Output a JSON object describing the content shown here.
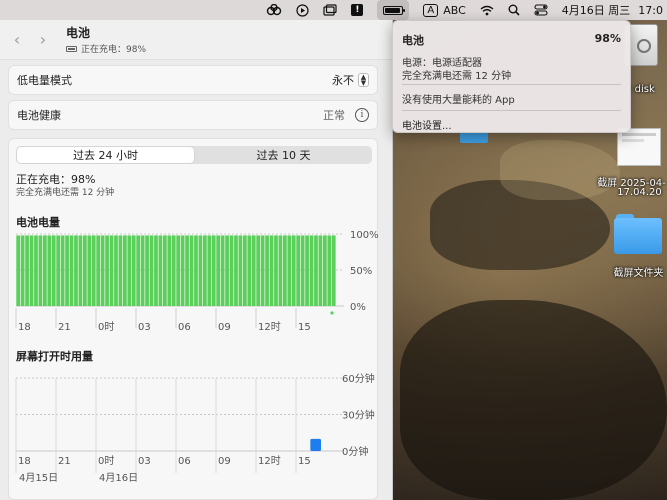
{
  "menubar": {
    "icons": [
      "link-rings-icon",
      "play-circle-icon",
      "window-stack-icon",
      "warning-icon",
      "battery-charging-icon",
      "input-method-a-icon",
      "wifi-icon",
      "search-icon",
      "control-center-icon"
    ],
    "input_label": "ABC",
    "date": "4月16日 周三",
    "time": "17:0"
  },
  "window": {
    "title": "电池",
    "subtitle": "正在充电：98%",
    "low_power": {
      "label": "低电量模式",
      "value": "永不"
    },
    "health": {
      "label": "电池健康",
      "value": "正常"
    },
    "segments": [
      "过去 24 小时",
      "过去 10 天"
    ],
    "charge_status": "正在充电：98%",
    "charge_sub": "完全充满电还需 12 分钟",
    "chart1_title": "电池电量",
    "chart2_title": "屏幕打开时用量"
  },
  "chart_data": [
    {
      "type": "bar",
      "title": "电池电量",
      "x_tick_labels": [
        "18",
        "21",
        "0时",
        "03",
        "06",
        "09",
        "12时",
        "15"
      ],
      "y_tick_labels": [
        "100%",
        "50%",
        "0%"
      ],
      "ylim": [
        0,
        100
      ],
      "bar_count": 72,
      "values": [
        98,
        98,
        98,
        98,
        98,
        98,
        98,
        98,
        98,
        98,
        98,
        98,
        98,
        98,
        98,
        98,
        98,
        98,
        98,
        98,
        98,
        98,
        98,
        98,
        98,
        98,
        98,
        98,
        98,
        98,
        98,
        98,
        98,
        98,
        98,
        98,
        98,
        98,
        98,
        98,
        98,
        98,
        98,
        98,
        98,
        98,
        98,
        98,
        98,
        98,
        98,
        98,
        98,
        98,
        98,
        98,
        98,
        98,
        98,
        98,
        98,
        98,
        98,
        98,
        98,
        98,
        98,
        98,
        98,
        98,
        98,
        98
      ],
      "color": "#5ad05a",
      "grid": true
    },
    {
      "type": "bar",
      "title": "屏幕打开时用量",
      "x_tick_labels": [
        "18",
        "21",
        "0时",
        "03",
        "06",
        "09",
        "12时",
        "15"
      ],
      "date_labels": [
        "4月15日",
        "4月16日"
      ],
      "y_tick_labels": [
        "60分钟",
        "30分钟",
        "0分钟"
      ],
      "ylim": [
        0,
        60
      ],
      "values": [
        {
          "x": "16",
          "y": 10
        }
      ],
      "color": "#1e7ef0",
      "grid": true
    }
  ],
  "dropdown": {
    "title": "电池",
    "percent": "98%",
    "power_source": "电源：电源适配器",
    "full_time": "完全充满电还需 12 分钟",
    "no_apps": "没有使用大量能耗的 App",
    "settings": "电池设置..."
  },
  "desktop": {
    "disk_label": "c disk",
    "screenshot_label_1": "截屏 2025-04-",
    "screenshot_label_2": "17.04.20",
    "folder_label": "截屏文件夹"
  }
}
